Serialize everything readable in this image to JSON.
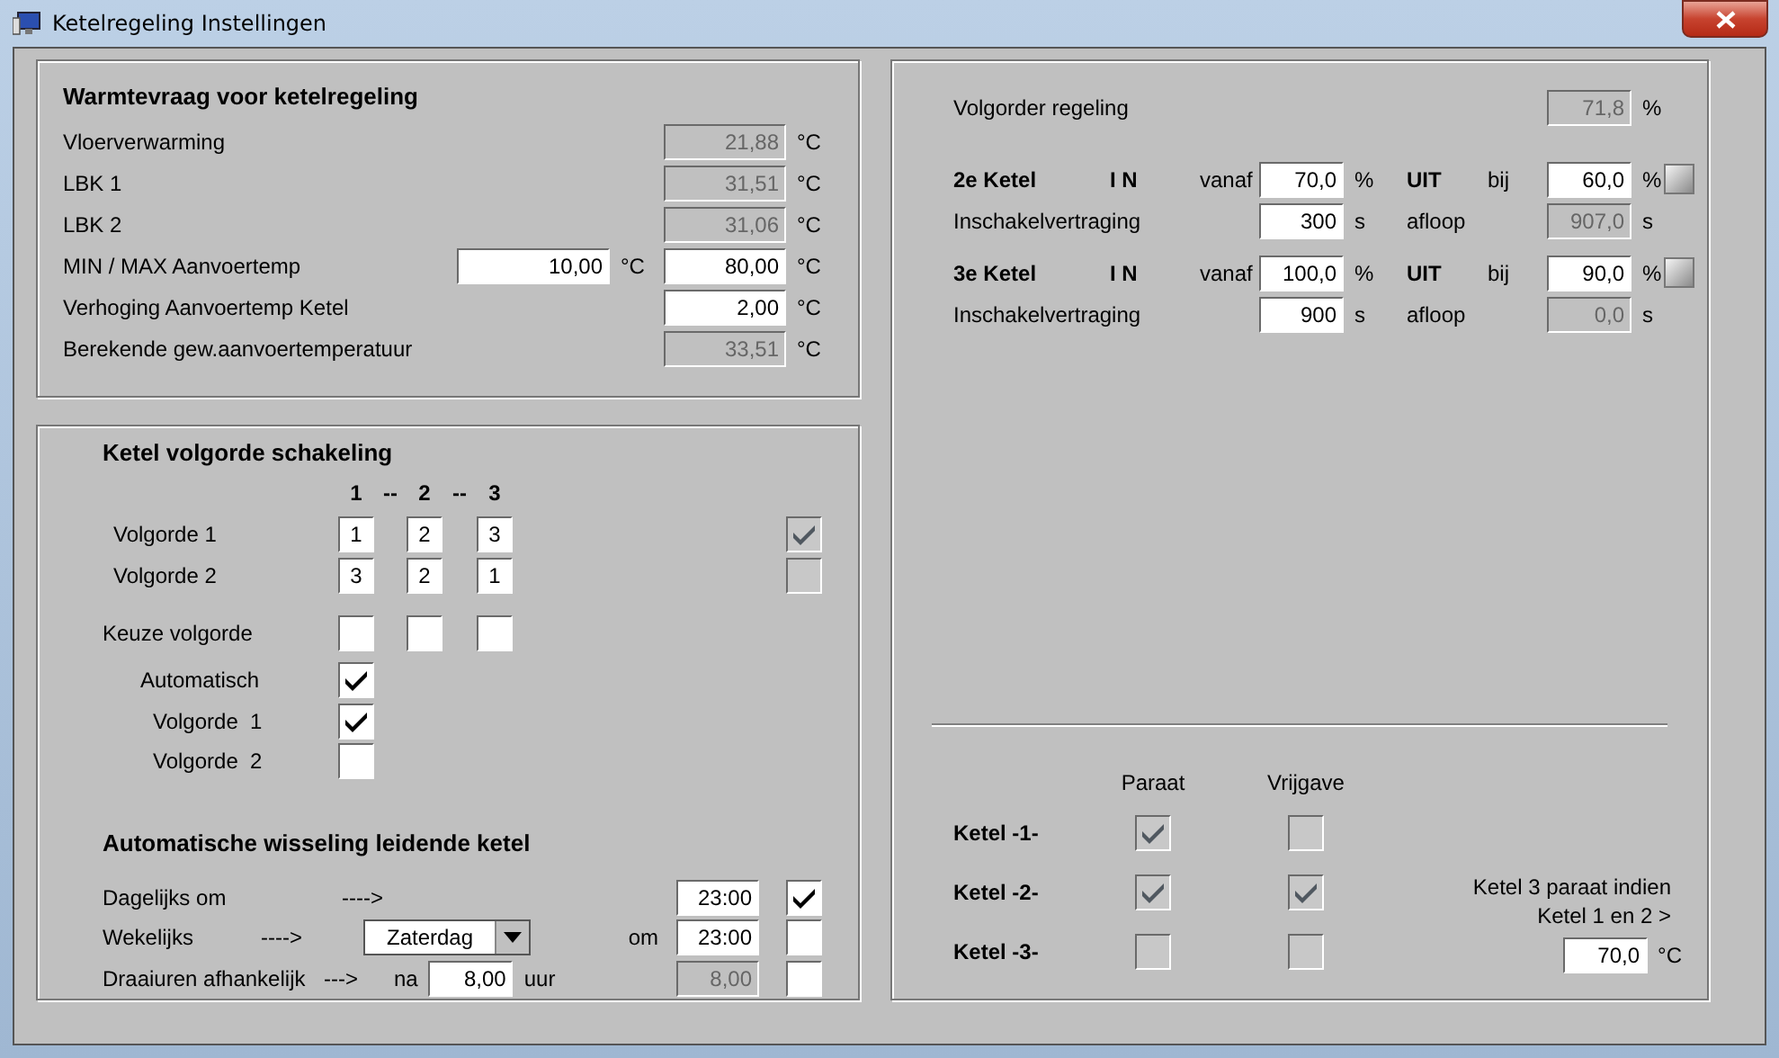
{
  "window": {
    "title": "Ketelregeling Instellingen"
  },
  "warmtevraag": {
    "title": "Warmtevraag voor ketelregeling",
    "rows": [
      {
        "label": "Vloerverwarming",
        "fields": [
          {
            "value": "21,88",
            "unit": "°C",
            "disabled": true
          }
        ]
      },
      {
        "label": "LBK 1",
        "fields": [
          {
            "value": "31,51",
            "unit": "°C",
            "disabled": true
          }
        ]
      },
      {
        "label": "LBK 2",
        "fields": [
          {
            "value": "31,06",
            "unit": "°C",
            "disabled": true
          }
        ]
      },
      {
        "label": "MIN / MAX Aanvoertemp",
        "fields": [
          {
            "value": "10,00",
            "unit": "°C",
            "disabled": false
          },
          {
            "value": "80,00",
            "unit": "°C",
            "disabled": false
          }
        ]
      },
      {
        "label": "Verhoging Aanvoertemp Ketel",
        "fields": [
          {
            "value": "2,00",
            "unit": "°C",
            "disabled": false
          }
        ]
      },
      {
        "label": "Berekende gew.aanvoertemperatuur",
        "fields": [
          {
            "value": "33,51",
            "unit": "°C",
            "disabled": true
          }
        ]
      }
    ]
  },
  "volgorde": {
    "title": "Ketel volgorde schakeling",
    "header": [
      "1",
      "--",
      "2",
      "--",
      "3"
    ],
    "rows": [
      {
        "label": "Volgorde 1",
        "values": [
          "1",
          "2",
          "3"
        ],
        "checkbox": {
          "checked": true,
          "disabled": true
        }
      },
      {
        "label": "Volgorde 2",
        "values": [
          "3",
          "2",
          "1"
        ],
        "checkbox": {
          "checked": false,
          "disabled": true
        }
      }
    ],
    "keuze": {
      "label": "Keuze volgorde",
      "fields": [
        {
          "disabled": false
        },
        {
          "disabled": false
        },
        {
          "disabled": false
        }
      ]
    },
    "options": [
      {
        "label": "Automatisch",
        "checked": true
      },
      {
        "label": "Volgorde  1",
        "checked": true
      },
      {
        "label": "Volgorde  2",
        "checked": false
      }
    ]
  },
  "wisseling": {
    "title": "Automatische wisseling leidende ketel",
    "rows": [
      {
        "kind": "daily",
        "label": "Dagelijks om",
        "arrow": "---->",
        "field": {
          "value": "23:00",
          "disabled": false
        },
        "checked": true
      },
      {
        "kind": "weekly",
        "label": "Wekelijks",
        "arrow": "---->",
        "dropdown": "Zaterdag",
        "om": "om",
        "field": {
          "value": "23:00",
          "disabled": false
        },
        "checked": false
      },
      {
        "kind": "hours",
        "label": "Draaiuren afhankelijk",
        "arrow": "--->",
        "prefix": "na",
        "input": {
          "value": "8,00",
          "disabled": false
        },
        "input_unit": "uur",
        "field": {
          "value": "8,00",
          "disabled": true
        },
        "checked": false
      }
    ]
  },
  "regeling": {
    "label": "Volgorder regeling",
    "field": {
      "value": "71,8",
      "unit": "%",
      "disabled": true
    }
  },
  "ketels": [
    {
      "name": "2e Ketel",
      "in": "I N",
      "vanaf": "vanaf",
      "in_field": {
        "value": "70,0",
        "unit": "%",
        "disabled": false
      },
      "uit": "UIT",
      "bij": "bij",
      "uit_field": {
        "value": "60,0",
        "unit": "%",
        "disabled": false
      },
      "delay_label": "Inschakelvertraging",
      "delay": {
        "value": "300",
        "unit": "s",
        "disabled": false
      },
      "afloop": "afloop",
      "afloop_field": {
        "value": "907,0",
        "unit": "s",
        "disabled": true
      }
    },
    {
      "name": "3e Ketel",
      "in": "I N",
      "vanaf": "vanaf",
      "in_field": {
        "value": "100,0",
        "unit": "%",
        "disabled": false
      },
      "uit": "UIT",
      "bij": "bij",
      "uit_field": {
        "value": "90,0",
        "unit": "%",
        "disabled": false
      },
      "delay_label": "Inschakelvertraging",
      "delay": {
        "value": "900",
        "unit": "s",
        "disabled": false
      },
      "afloop": "afloop",
      "afloop_field": {
        "value": "0,0",
        "unit": "s",
        "disabled": true
      }
    }
  ],
  "status": {
    "columns": [
      "Paraat",
      "Vrijgave"
    ],
    "rows": [
      {
        "name": "Ketel -1-",
        "paraat": {
          "checked": true,
          "disabled": true
        },
        "vrijgave": {
          "checked": false,
          "disabled": true
        }
      },
      {
        "name": "Ketel -2-",
        "paraat": {
          "checked": true,
          "disabled": true
        },
        "vrijgave": {
          "checked": true,
          "disabled": true
        }
      },
      {
        "name": "Ketel -3-",
        "paraat": {
          "checked": false,
          "disabled": true
        },
        "vrijgave": {
          "checked": false,
          "disabled": true
        }
      }
    ],
    "note_lines": [
      "Ketel 3 paraat indien",
      "Ketel 1 en 2 >"
    ],
    "note_field": {
      "value": "70,0",
      "unit": "°C",
      "disabled": false
    }
  }
}
